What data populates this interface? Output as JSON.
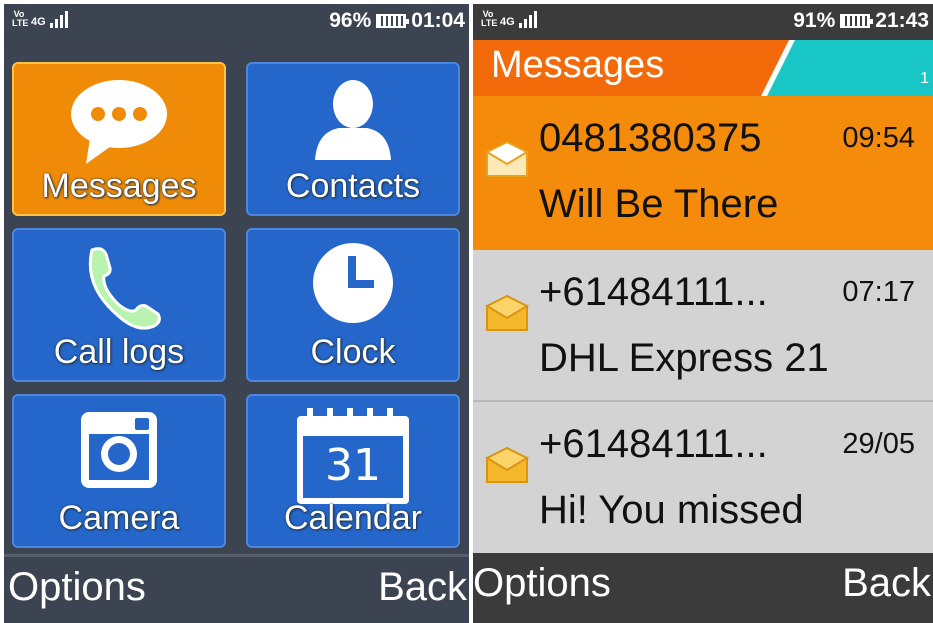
{
  "left_screen": {
    "status": {
      "volte": "Vo LTE",
      "network": "4G",
      "battery_percent": "96%",
      "time": "01:04"
    },
    "tiles": [
      {
        "label": "Messages",
        "icon": "chat-bubble-icon",
        "selected": true
      },
      {
        "label": "Contacts",
        "icon": "person-icon",
        "selected": false
      },
      {
        "label": "Call logs",
        "icon": "phone-handset-icon",
        "selected": false
      },
      {
        "label": "Clock",
        "icon": "clock-icon",
        "selected": false
      },
      {
        "label": "Camera",
        "icon": "camera-icon",
        "selected": false
      },
      {
        "label": "Calendar",
        "icon": "calendar-icon",
        "selected": false,
        "calendar_day": "31"
      }
    ],
    "softkeys": {
      "left": "Options",
      "right": "Back"
    }
  },
  "right_screen": {
    "status": {
      "volte": "Vo LTE",
      "network": "4G",
      "battery_percent": "91%",
      "time": "21:43"
    },
    "header": {
      "title": "Messages",
      "count": "1"
    },
    "messages": [
      {
        "sender": "0481380375",
        "time": "09:54",
        "preview": "Will Be There",
        "selected": true
      },
      {
        "sender": "+61484111...",
        "time": "07:17",
        "preview": "DHL Express 21",
        "selected": false
      },
      {
        "sender": "+61484111...",
        "time": "29/05",
        "preview": "Hi! You missed",
        "selected": false
      }
    ],
    "softkeys": {
      "left": "Options",
      "right": "Back"
    }
  },
  "colors": {
    "tile_blue": "#2466c9",
    "tile_selected_orange": "#ef8b06",
    "header_orange": "#f36a0b",
    "header_teal": "#19c6c6",
    "row_selected": "#f48b0a",
    "row_background": "#d3d3d3",
    "envelope": "#f5b72c"
  }
}
